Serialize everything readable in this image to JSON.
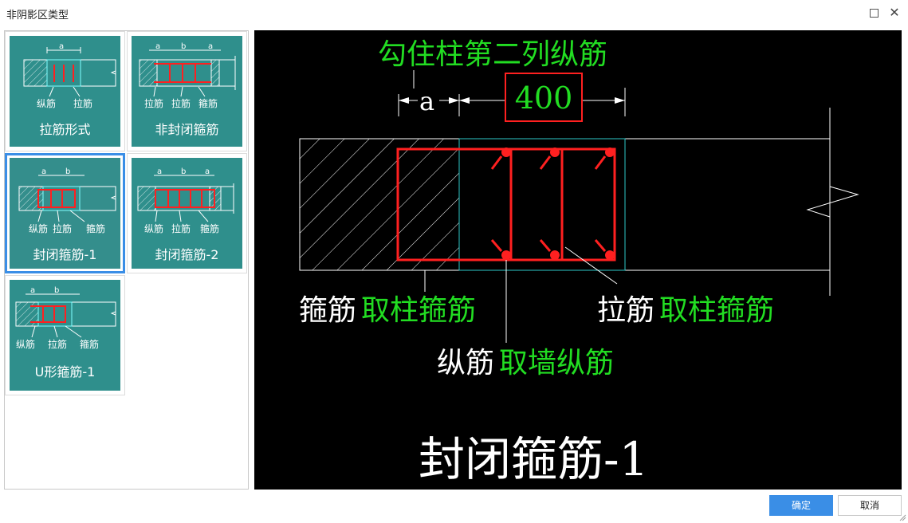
{
  "window": {
    "title": "非阴影区类型"
  },
  "options": [
    {
      "caption": "拉筋形式",
      "labels": [
        "纵筋",
        "拉筋"
      ],
      "dims": [
        "a"
      ]
    },
    {
      "caption": "非封闭箍筋",
      "labels": [
        "拉筋",
        "拉筋",
        "箍筋"
      ],
      "dims": [
        "a",
        "b",
        "a"
      ]
    },
    {
      "caption": "封闭箍筋-1",
      "labels": [
        "纵筋",
        "拉筋",
        "箍筋"
      ],
      "dims": [
        "a",
        "b"
      ],
      "selected": true
    },
    {
      "caption": "封闭箍筋-2",
      "labels": [
        "纵筋",
        "拉筋",
        "箍筋"
      ],
      "dims": [
        "a",
        "b",
        "a"
      ]
    },
    {
      "caption": "U形箍筋-1",
      "labels": [
        "纵筋",
        "拉筋",
        "箍筋"
      ],
      "dims": [
        "a",
        "b"
      ]
    }
  ],
  "preview": {
    "header": "勾住柱第二列纵筋",
    "dim_a": "a",
    "dim_value": "400",
    "stirrup_label": "箍筋",
    "stirrup_value": "取柱箍筋",
    "tie_label": "拉筋",
    "tie_value": "取柱箍筋",
    "long_label": "纵筋",
    "long_value": "取墙纵筋",
    "caption": "封闭箍筋-1"
  },
  "buttons": {
    "ok": "确定",
    "cancel": "取消"
  },
  "colors": {
    "accent": "#3a8ee6",
    "thumb_bg": "#2f8f8c",
    "rebar": "#ff2020",
    "highlight": "#22dd22"
  }
}
